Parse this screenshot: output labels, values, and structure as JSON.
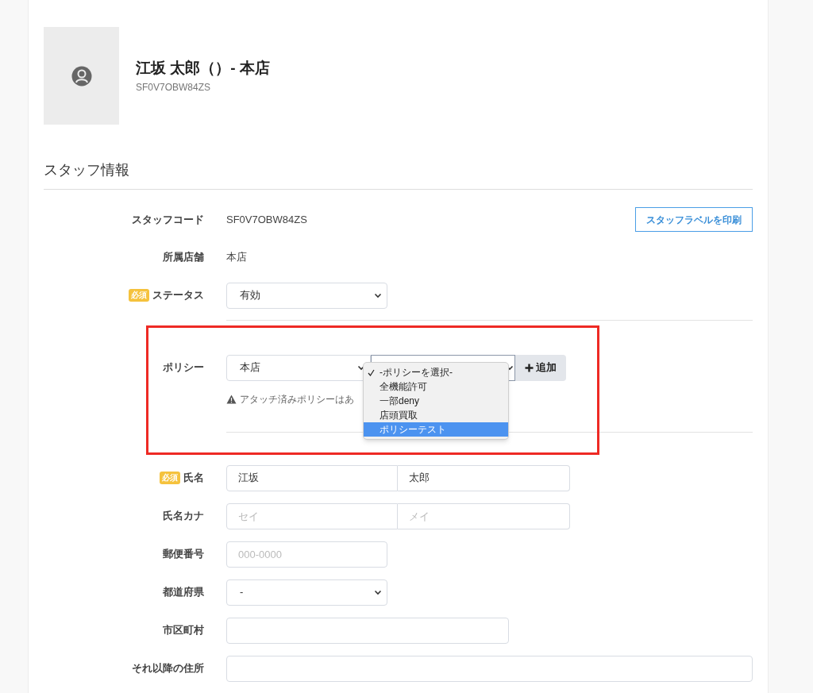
{
  "header": {
    "title": "江坂 太郎（）- 本店",
    "code": "SF0V7OBW84ZS"
  },
  "section_title": "スタッフ情報",
  "print_button": "スタッフラベルを印刷",
  "fields": [
    {
      "kind": "text",
      "label": "スタッフコード",
      "value": "SF0V7OBW84ZS"
    },
    {
      "kind": "text",
      "label": "所属店舗",
      "value": "本店"
    },
    {
      "kind": "select",
      "label": "ステータス",
      "badge": "必須",
      "value": "有効"
    }
  ],
  "policy": {
    "label": "ポリシー",
    "store_select": "本店",
    "add_button": "追加",
    "warning": "アタッチ済みポリシーはあ",
    "menu": [
      {
        "label": "-ポリシーを選択-",
        "checked": true,
        "highlighted": false
      },
      {
        "label": "全機能許可",
        "checked": false,
        "highlighted": false
      },
      {
        "label": "一部deny",
        "checked": false,
        "highlighted": false
      },
      {
        "label": "店頭買取",
        "checked": false,
        "highlighted": false
      },
      {
        "label": "ポリシーテスト",
        "checked": false,
        "highlighted": true
      }
    ]
  },
  "fields2": [
    {
      "kind": "pair",
      "label": "氏名",
      "badge": "必須",
      "inputs": [
        {
          "value": "江坂"
        },
        {
          "value": "太郎"
        }
      ]
    },
    {
      "kind": "pair",
      "label": "氏名カナ",
      "inputs": [
        {
          "placeholder": "セイ"
        },
        {
          "placeholder": "メイ"
        }
      ]
    },
    {
      "kind": "input",
      "label": "郵便番号",
      "placeholder": "000-0000"
    },
    {
      "kind": "select",
      "label": "都道府県",
      "value": "-"
    },
    {
      "kind": "input",
      "label": "市区町村"
    },
    {
      "kind": "input",
      "label": "それ以降の住所"
    }
  ]
}
